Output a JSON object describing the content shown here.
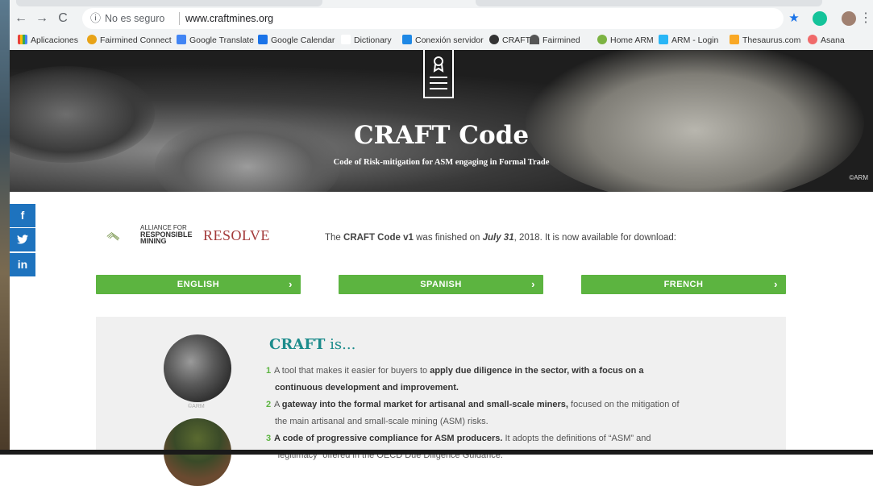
{
  "browser": {
    "security": "No es seguro",
    "url": "www.craftmines.org",
    "bookmarks": [
      "Aplicaciones",
      "Fairmined Connect",
      "Google Translate",
      "Google Calendar",
      "Dictionary",
      "Conexión servidor",
      "CRAFT",
      "Fairmined",
      "Home ARM",
      "ARM - Login",
      "Thesaurus.com",
      "Asana"
    ]
  },
  "hero": {
    "title": "CRAFT Code",
    "subtitle": "Code of Risk-mitigation for ASM engaging in Formal Trade",
    "credit": "©ARM"
  },
  "social": [
    "f",
    "t",
    "in"
  ],
  "logos": {
    "arm": [
      "ALLIANCE FOR",
      "RESPONSIBLE",
      "MINING"
    ],
    "resolve": "RESOLVE"
  },
  "intro": {
    "pre": "The ",
    "code": "CRAFT Code v1",
    "mid": " was finished on ",
    "date": "July 31",
    "post": ", 2018. It is now available for download:"
  },
  "languages": [
    "ENGLISH",
    "SPANISH",
    "FRENCH"
  ],
  "craft_is": {
    "title_bold": "CRAFT",
    "title_rest": " is...",
    "photo_credit": "©ARM",
    "items": [
      {
        "n": "1",
        "a": "A tool that makes it easier for buyers to ",
        "b": "apply due diligence in the sector, with a focus on a",
        "c": "continuous development and improvement.",
        "d": ""
      },
      {
        "n": "2",
        "a": "A ",
        "b": "gateway into the formal market for artisanal and small-scale miners,",
        "c": " focused on the mitigation of",
        "d": "the main artisanal and small-scale mining (ASM) risks."
      },
      {
        "n": "3",
        "a": "",
        "b": "A code of progressive compliance for ASM producers.",
        "c": " It adopts the definitions of “ASM” and",
        "d": "“legitimacy” offered in the OECD Due Diligence Guidance."
      }
    ]
  }
}
